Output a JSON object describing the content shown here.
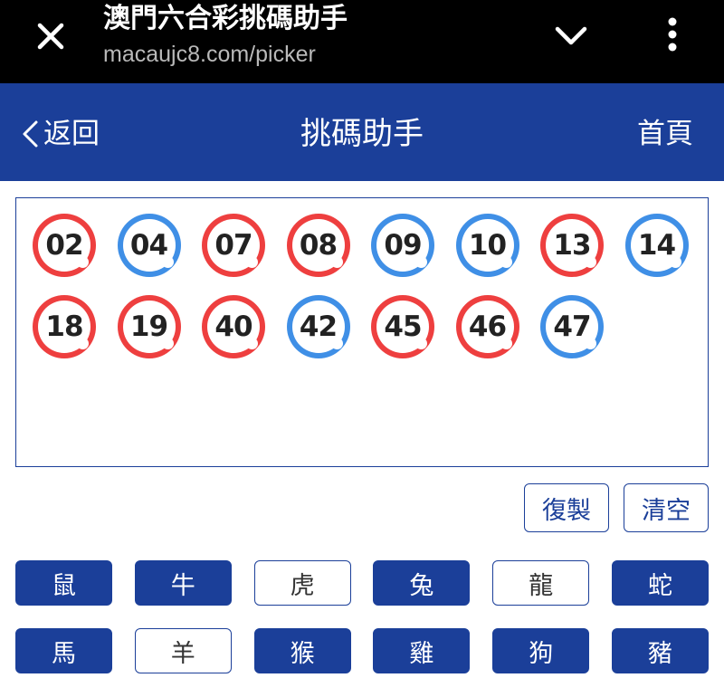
{
  "browser": {
    "title": "澳門六合彩挑碼助手",
    "url": "macaujc8.com/picker"
  },
  "header": {
    "back_label": "返回",
    "title": "挑碼助手",
    "home_label": "首頁"
  },
  "selected_numbers": [
    {
      "num": "02",
      "color": "red"
    },
    {
      "num": "04",
      "color": "blue"
    },
    {
      "num": "07",
      "color": "red"
    },
    {
      "num": "08",
      "color": "red"
    },
    {
      "num": "09",
      "color": "blue"
    },
    {
      "num": "10",
      "color": "blue"
    },
    {
      "num": "13",
      "color": "red"
    },
    {
      "num": "14",
      "color": "blue"
    },
    {
      "num": "18",
      "color": "red"
    },
    {
      "num": "19",
      "color": "red"
    },
    {
      "num": "40",
      "color": "red"
    },
    {
      "num": "42",
      "color": "blue"
    },
    {
      "num": "45",
      "color": "red"
    },
    {
      "num": "46",
      "color": "red"
    },
    {
      "num": "47",
      "color": "blue"
    }
  ],
  "actions": {
    "copy_label": "復製",
    "clear_label": "清空"
  },
  "zodiacs": [
    {
      "label": "鼠",
      "selected": true
    },
    {
      "label": "牛",
      "selected": true
    },
    {
      "label": "虎",
      "selected": false
    },
    {
      "label": "兔",
      "selected": true
    },
    {
      "label": "龍",
      "selected": false
    },
    {
      "label": "蛇",
      "selected": true
    },
    {
      "label": "馬",
      "selected": true
    },
    {
      "label": "羊",
      "selected": false
    },
    {
      "label": "猴",
      "selected": true
    },
    {
      "label": "雞",
      "selected": true
    },
    {
      "label": "狗",
      "selected": true
    },
    {
      "label": "豬",
      "selected": true
    }
  ],
  "colors": {
    "brand_blue": "#1b3f99",
    "ball_red": "#ee3f3f",
    "ball_blue": "#3f8fe6"
  },
  "icons": [
    "close-icon",
    "chevron-down-icon",
    "more-vert-icon",
    "chevron-left-icon"
  ]
}
